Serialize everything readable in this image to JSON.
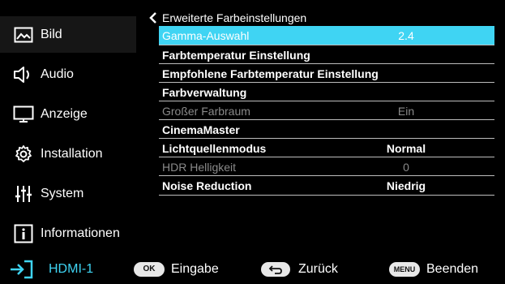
{
  "sidebar": {
    "items": [
      {
        "label": "Bild",
        "icon": "picture-icon",
        "active": true
      },
      {
        "label": "Audio",
        "icon": "speaker-icon",
        "active": false
      },
      {
        "label": "Anzeige",
        "icon": "monitor-icon",
        "active": false
      },
      {
        "label": "Installation",
        "icon": "gear-icon",
        "active": false
      },
      {
        "label": "System",
        "icon": "sliders-icon",
        "active": false
      },
      {
        "label": "Informationen",
        "icon": "info-icon",
        "active": false
      }
    ]
  },
  "panel": {
    "title": "Erweiterte Farbeinstellungen",
    "rows": [
      {
        "label": "Gamma-Auswahl",
        "value": "2.4"
      },
      {
        "label": "Farbtemperatur Einstellung",
        "value": ""
      },
      {
        "label": "Empfohlene Farbtemperatur Einstellung",
        "value": ""
      },
      {
        "label": "Farbverwaltung",
        "value": ""
      },
      {
        "label": "Großer Farbraum",
        "value": "Ein"
      },
      {
        "label": "CinemaMaster",
        "value": ""
      },
      {
        "label": "Lichtquellenmodus",
        "value": "Normal"
      },
      {
        "label": "HDR Helligkeit",
        "value": "0"
      },
      {
        "label": "Noise Reduction",
        "value": "Niedrig"
      }
    ]
  },
  "footer": {
    "source": "HDMI-1",
    "ok_key": "OK",
    "ok_label": "Eingabe",
    "back_label": "Zurück",
    "menu_key": "MENU",
    "menu_label": "Beenden"
  },
  "colors": {
    "highlight": "#3fd4f3",
    "source_text": "#3fd4f3",
    "dim_text": "#8a8a8a",
    "background": "#000000"
  }
}
